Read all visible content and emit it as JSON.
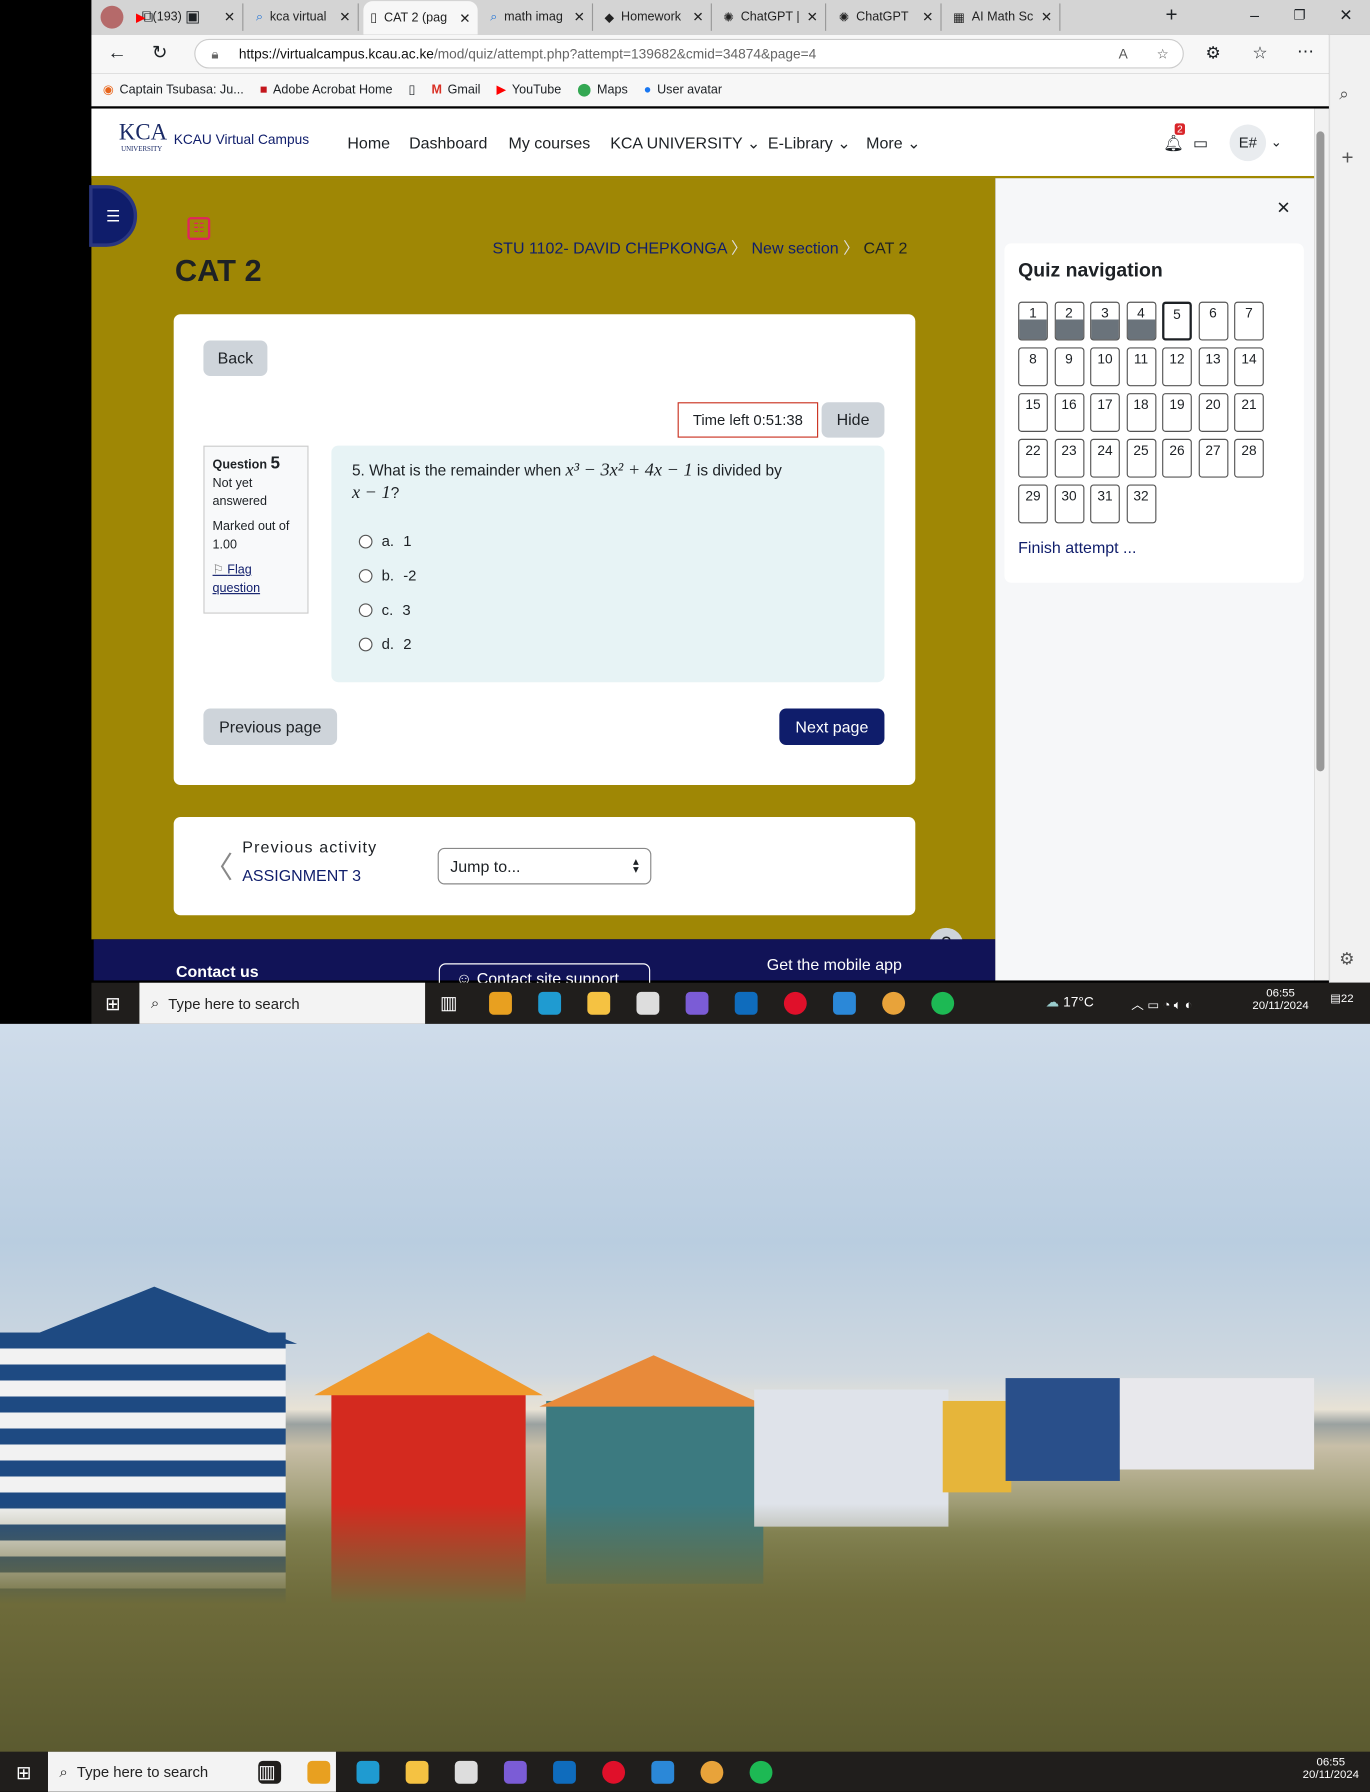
{
  "browser": {
    "tabs": [
      {
        "label": "(193)",
        "icon": "youtube-icon"
      },
      {
        "label": "kca virtual",
        "icon": "search-icon"
      },
      {
        "label": "CAT 2 (pag",
        "icon": "page-icon",
        "active": true
      },
      {
        "label": "math imag",
        "icon": "search-icon"
      },
      {
        "label": "Homework",
        "icon": "ai-icon"
      },
      {
        "label": "ChatGPT |",
        "icon": "chatgpt-icon"
      },
      {
        "label": "ChatGPT",
        "icon": "chatgpt-icon"
      },
      {
        "label": "AI Math Sc",
        "icon": "calculator-icon"
      }
    ],
    "url_domain": "https://virtualcampus.kcau.ac.ke",
    "url_path": "/mod/quiz/attempt.php?attempt=139682&cmid=34874&page=4",
    "bookmarks": [
      "Captain Tsubasa: Ju...",
      "Adobe Acrobat Home",
      "",
      "Gmail",
      "YouTube",
      "Maps",
      "User avatar"
    ]
  },
  "site": {
    "name": "KCAU Virtual Campus",
    "logo_text": "KCA UNIVERSITY",
    "nav": [
      "Home",
      "Dashboard",
      "My courses",
      "KCA UNIVERSITY",
      "E-Library",
      "More"
    ],
    "notification_count": "2",
    "user_initials": "E#"
  },
  "page": {
    "breadcrumb": [
      "STU 1102- DAVID CHEPKONGA",
      "New section",
      "CAT 2"
    ],
    "title": "CAT 2",
    "back": "Back",
    "timer": "Time left 0:51:38",
    "hide": "Hide",
    "question": {
      "label": "Question",
      "number": "5",
      "status": "Not yet answered",
      "marks": "Marked out of 1.00",
      "flag": "Flag question",
      "text_prefix": "5. What is the remainder when ",
      "expr": "x³ − 3x² + 4x − 1",
      "text_mid": " is divided by",
      "expr2": "x − 1",
      "text_suffix": "?",
      "options": [
        {
          "letter": "a.",
          "value": "1"
        },
        {
          "letter": "b.",
          "value": "-2"
        },
        {
          "letter": "c.",
          "value": "3"
        },
        {
          "letter": "d.",
          "value": "2"
        }
      ]
    },
    "prev_page": "Previous page",
    "next_page": "Next page",
    "prev_activity_label": "Previous activity",
    "prev_activity": "ASSIGNMENT 3",
    "jump_to": "Jump to...",
    "footer": {
      "contact": "Contact us",
      "support": "Contact site support",
      "mobile": "Get the mobile app",
      "help": "?"
    }
  },
  "quiz_nav": {
    "title": "Quiz navigation",
    "answered": [
      1,
      2,
      3,
      4
    ],
    "current": 5,
    "total": 32,
    "finish": "Finish attempt ..."
  },
  "taskbar": {
    "search": "Type here to search",
    "weather": "17°C",
    "time": "06:55",
    "date": "20/11/2024",
    "notifications": "22"
  },
  "colors": {
    "olive": "#9f8705",
    "navy": "#111357",
    "accent": "#0f1d6b"
  }
}
